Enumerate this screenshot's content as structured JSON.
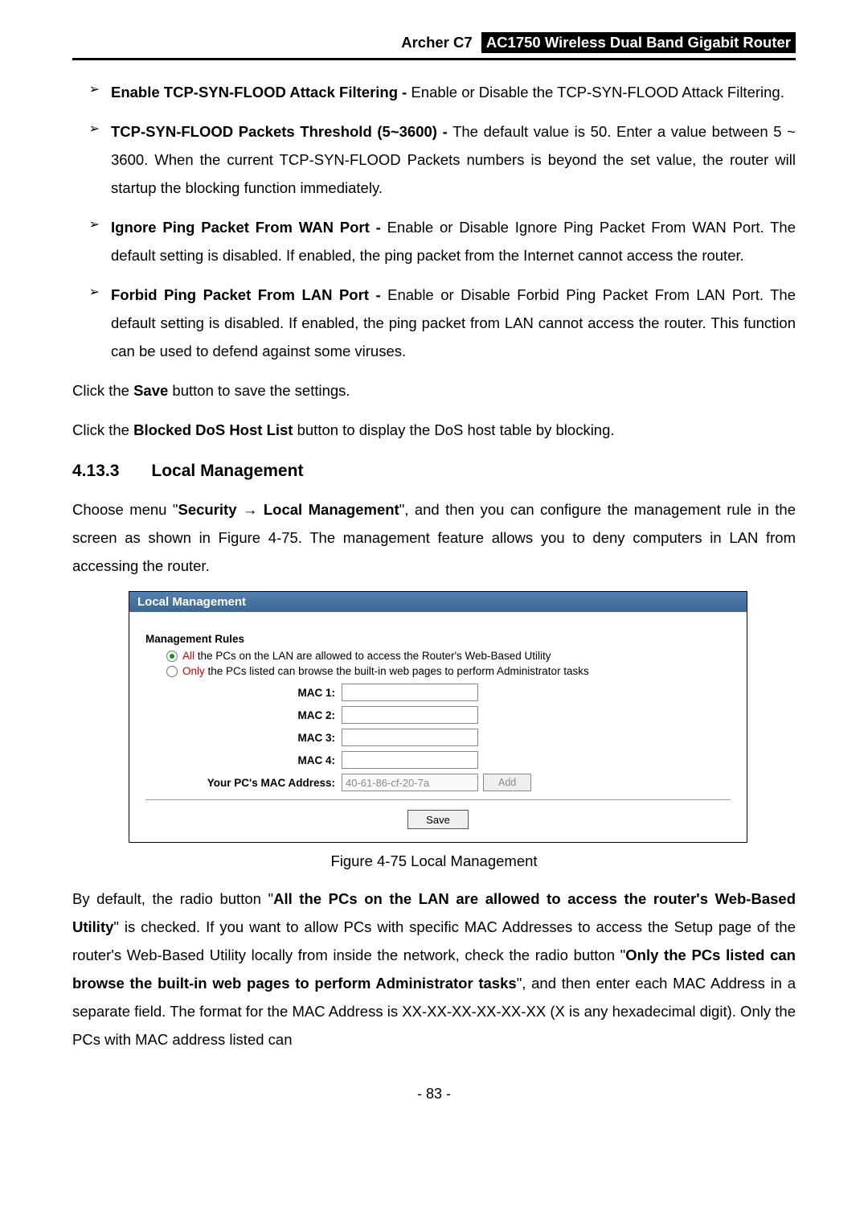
{
  "header": {
    "model": "Archer C7",
    "product": "AC1750 Wireless Dual Band Gigabit Router"
  },
  "bullets": [
    {
      "title": "Enable TCP-SYN-FLOOD Attack Filtering -",
      "body": " Enable or Disable the TCP-SYN-FLOOD Attack Filtering."
    },
    {
      "title": "TCP-SYN-FLOOD Packets Threshold (5~3600) -",
      "body": " The default value is 50. Enter a value between 5 ~ 3600. When the current TCP-SYN-FLOOD Packets numbers is beyond the set value, the router will startup the blocking function immediately."
    },
    {
      "title": "Ignore Ping Packet From WAN Port -",
      "body": " Enable or Disable Ignore Ping Packet From WAN Port. The default setting is disabled. If enabled, the ping packet from the Internet cannot access the router."
    },
    {
      "title": "Forbid Ping Packet From LAN Port -",
      "body": " Enable or Disable Forbid Ping Packet From LAN Port. The default setting is disabled. If enabled, the ping packet from LAN cannot access the router. This function can be used to defend against some viruses."
    }
  ],
  "paras": {
    "save": {
      "pre": "Click the ",
      "bold": "Save",
      "post": " button to save the settings."
    },
    "blocked": {
      "pre": "Click the ",
      "bold": "Blocked DoS Host List",
      "post": " button to display the DoS host table by blocking."
    }
  },
  "section": {
    "num": "4.13.3",
    "title": "Local Management"
  },
  "intro": {
    "pre": "Choose menu \"",
    "b1": "Security",
    "mid1": " → ",
    "b2": "Local Management",
    "post": "\", and then you can configure the management rule in the screen as shown in Figure 4-75. The management feature allows you to deny computers in LAN from accessing the router."
  },
  "figure": {
    "title": "Local Management",
    "rules_title": "Management Rules",
    "radio": {
      "opt1": {
        "red": "All",
        "rest": " the PCs on the LAN are allowed to access the Router's Web-Based Utility",
        "checked": true
      },
      "opt2": {
        "red": "Only",
        "rest": " the PCs listed can browse the built-in web pages to perform Administrator tasks",
        "checked": false
      }
    },
    "rows": [
      {
        "label": "MAC 1:",
        "value": ""
      },
      {
        "label": "MAC 2:",
        "value": ""
      },
      {
        "label": "MAC 3:",
        "value": ""
      },
      {
        "label": "MAC 4:",
        "value": ""
      }
    ],
    "pc_mac": {
      "label": "Your PC's MAC Address:",
      "value": "40-61-86-cf-20-7a",
      "add": "Add"
    },
    "save": "Save"
  },
  "caption": "Figure 4-75 Local Management",
  "closing": {
    "t1": "By default, the radio button \"",
    "b1": "All the PCs on the LAN are allowed to access the router's Web-Based Utility",
    "t2": "\" is checked. If you want to allow PCs with specific MAC Addresses to access the Setup page of the router's Web-Based Utility locally from inside the network, check the radio button \"",
    "b2": "Only the PCs listed can browse the built-in web pages to perform Administrator tasks",
    "t3": "\", and then enter each MAC Address in a separate field. The format for the MAC Address is XX-XX-XX-XX-XX-XX (X is any hexadecimal digit). Only the PCs with MAC address listed can"
  },
  "footer": "- 83 -"
}
